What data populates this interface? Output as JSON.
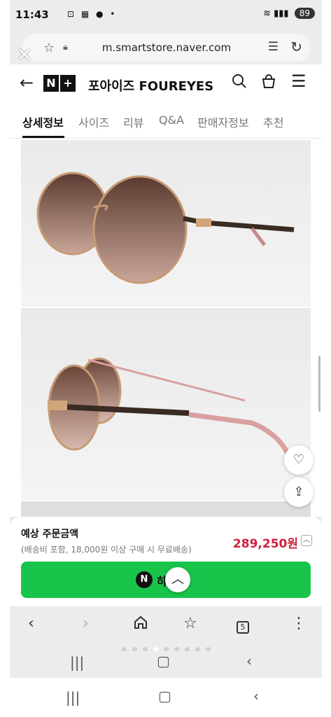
{
  "status": {
    "time": "11:43",
    "left_icons": "⊡ ▦ ● •",
    "battery": "89"
  },
  "browser": {
    "url": "m.smartstore.naver.com",
    "tab_count": "5"
  },
  "store": {
    "logo_letters": [
      "N",
      "+"
    ],
    "name": "포아이즈 FOUREYES"
  },
  "tabs": [
    {
      "label": "상세정보"
    },
    {
      "label": "사이즈"
    },
    {
      "label": "리뷰"
    },
    {
      "label": "Q&A"
    },
    {
      "label": "판매자정보"
    },
    {
      "label": "추천"
    }
  ],
  "order": {
    "title": "예상 주문금액",
    "note": "(배송비 포함, 18,000원 이상 구매 시 무료배송)",
    "price": "289,250원",
    "buy_badge": "N",
    "buy_label": "하기"
  },
  "colors": {
    "accent_green": "#19c44b",
    "price_red": "#d0203b"
  },
  "icons": [
    "close-icon",
    "star-icon",
    "lock-icon",
    "reader-icon",
    "reload-icon",
    "back-arrow-icon",
    "search-icon",
    "bag-icon",
    "menu-icon",
    "heart-check-icon",
    "share-icon",
    "chevron-up-icon",
    "chevron-left-icon",
    "chevron-right-icon",
    "home-icon",
    "bookmark-star-icon",
    "tabs-icon",
    "more-icon"
  ]
}
